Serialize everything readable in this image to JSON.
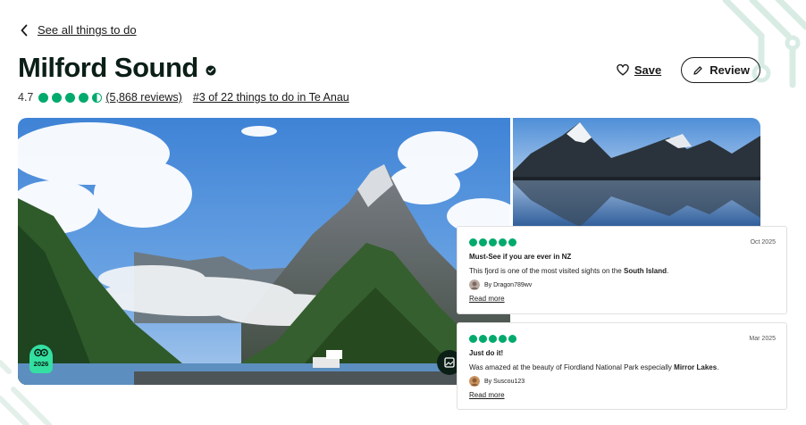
{
  "nav": {
    "back_label": "See all things to do"
  },
  "header": {
    "title": "Milford Sound",
    "save_label": "Save",
    "review_label": "Review"
  },
  "rating": {
    "score": "4.7",
    "bubbles": 4.5,
    "reviews_link": "(5,868 reviews)",
    "rank_link": "#3 of 22 things to do in Te Anau",
    "accent_color": "#00aa6c"
  },
  "gallery": {
    "award_year": "2026",
    "award_icon": "travellers-choice-owl-icon",
    "open_icon": "gallery-icon"
  },
  "reviews": [
    {
      "rating": 5,
      "date": "Oct 2025",
      "title": "Must-See if you are ever in NZ",
      "body_before": "This fjord is one of the most visited sights on the ",
      "body_bold": "South Island",
      "body_after": ".",
      "author": "By Dragon789wv",
      "read_more": "Read more"
    },
    {
      "rating": 5,
      "date": "Mar 2025",
      "title": "Just do it!",
      "body_before": "Was amazed at the beauty of Fiordland National Park especially ",
      "body_bold": "Mirror Lakes",
      "body_after": ".",
      "author": "By Suscou123",
      "read_more": "Read more"
    }
  ]
}
